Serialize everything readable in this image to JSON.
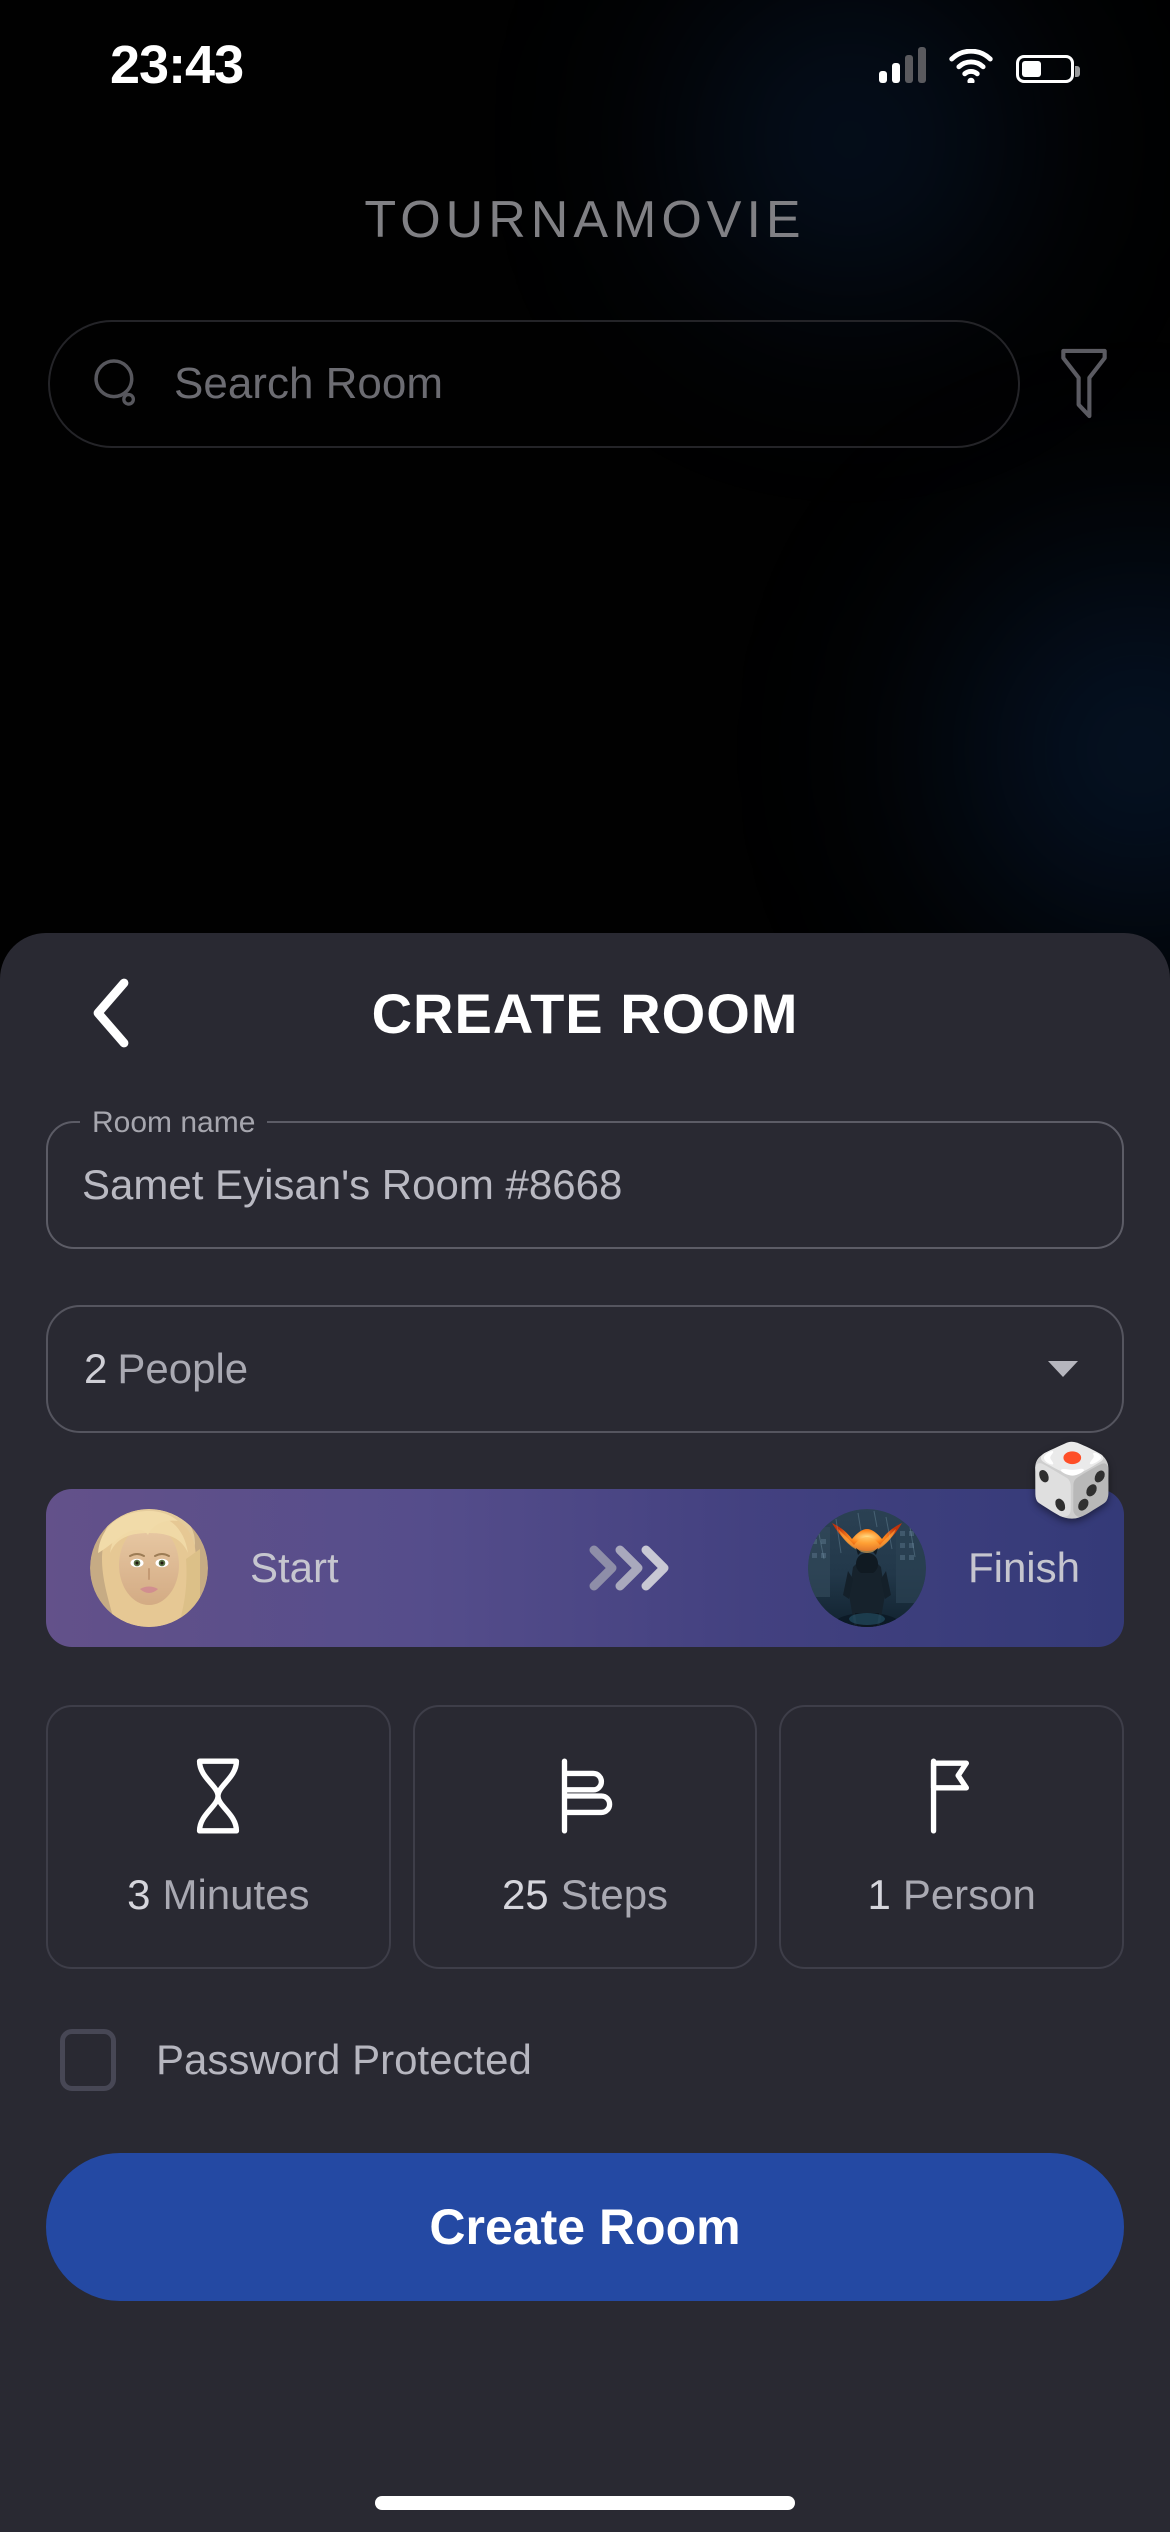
{
  "status_bar": {
    "time": "23:43",
    "signal_icon": "cellular-bars-icon",
    "wifi_icon": "wifi-icon",
    "battery_icon": "battery-icon",
    "battery_level_pct": 42
  },
  "app": {
    "title": "TOURNAMOVIE",
    "background_color": "#010101"
  },
  "search": {
    "placeholder": "Search Room",
    "value": "",
    "search_icon": "search-icon",
    "filter_icon": "filter-funnel-icon"
  },
  "sheet": {
    "title": "CREATE ROOM",
    "back_icon": "chevron-left-icon",
    "background_color": "#292932",
    "room_name": {
      "label": "Room name",
      "value": "Samet Eyisan's Room #8668",
      "placeholder": "Room name"
    },
    "capacity": {
      "count": "2",
      "unit": "People",
      "selected": "2 People",
      "caret_icon": "caret-down-icon"
    },
    "match_banner": {
      "start_label": "Start",
      "finish_label": "Finish",
      "start_avatar": "actress-portrait-avatar",
      "finish_avatar": "dark-knight-poster-avatar",
      "arrow_icon": "chevron-triple-right-icon",
      "shuffle_icon": "dice-icon",
      "gradient_from": "#63518a",
      "gradient_to": "#343a78"
    },
    "stats": [
      {
        "icon": "hourglass-icon",
        "value": "3",
        "unit": "Minutes"
      },
      {
        "icon": "steps-chart-icon",
        "value": "25",
        "unit": "Steps"
      },
      {
        "icon": "flag-icon",
        "value": "1",
        "unit": "Person"
      }
    ],
    "password_protected": {
      "label": "Password Protected",
      "checked": false,
      "checkbox_icon": "checkbox-unchecked-icon"
    },
    "submit": {
      "label": "Create Room",
      "color": "#2449a3"
    }
  },
  "home_indicator": "home-indicator-bar"
}
